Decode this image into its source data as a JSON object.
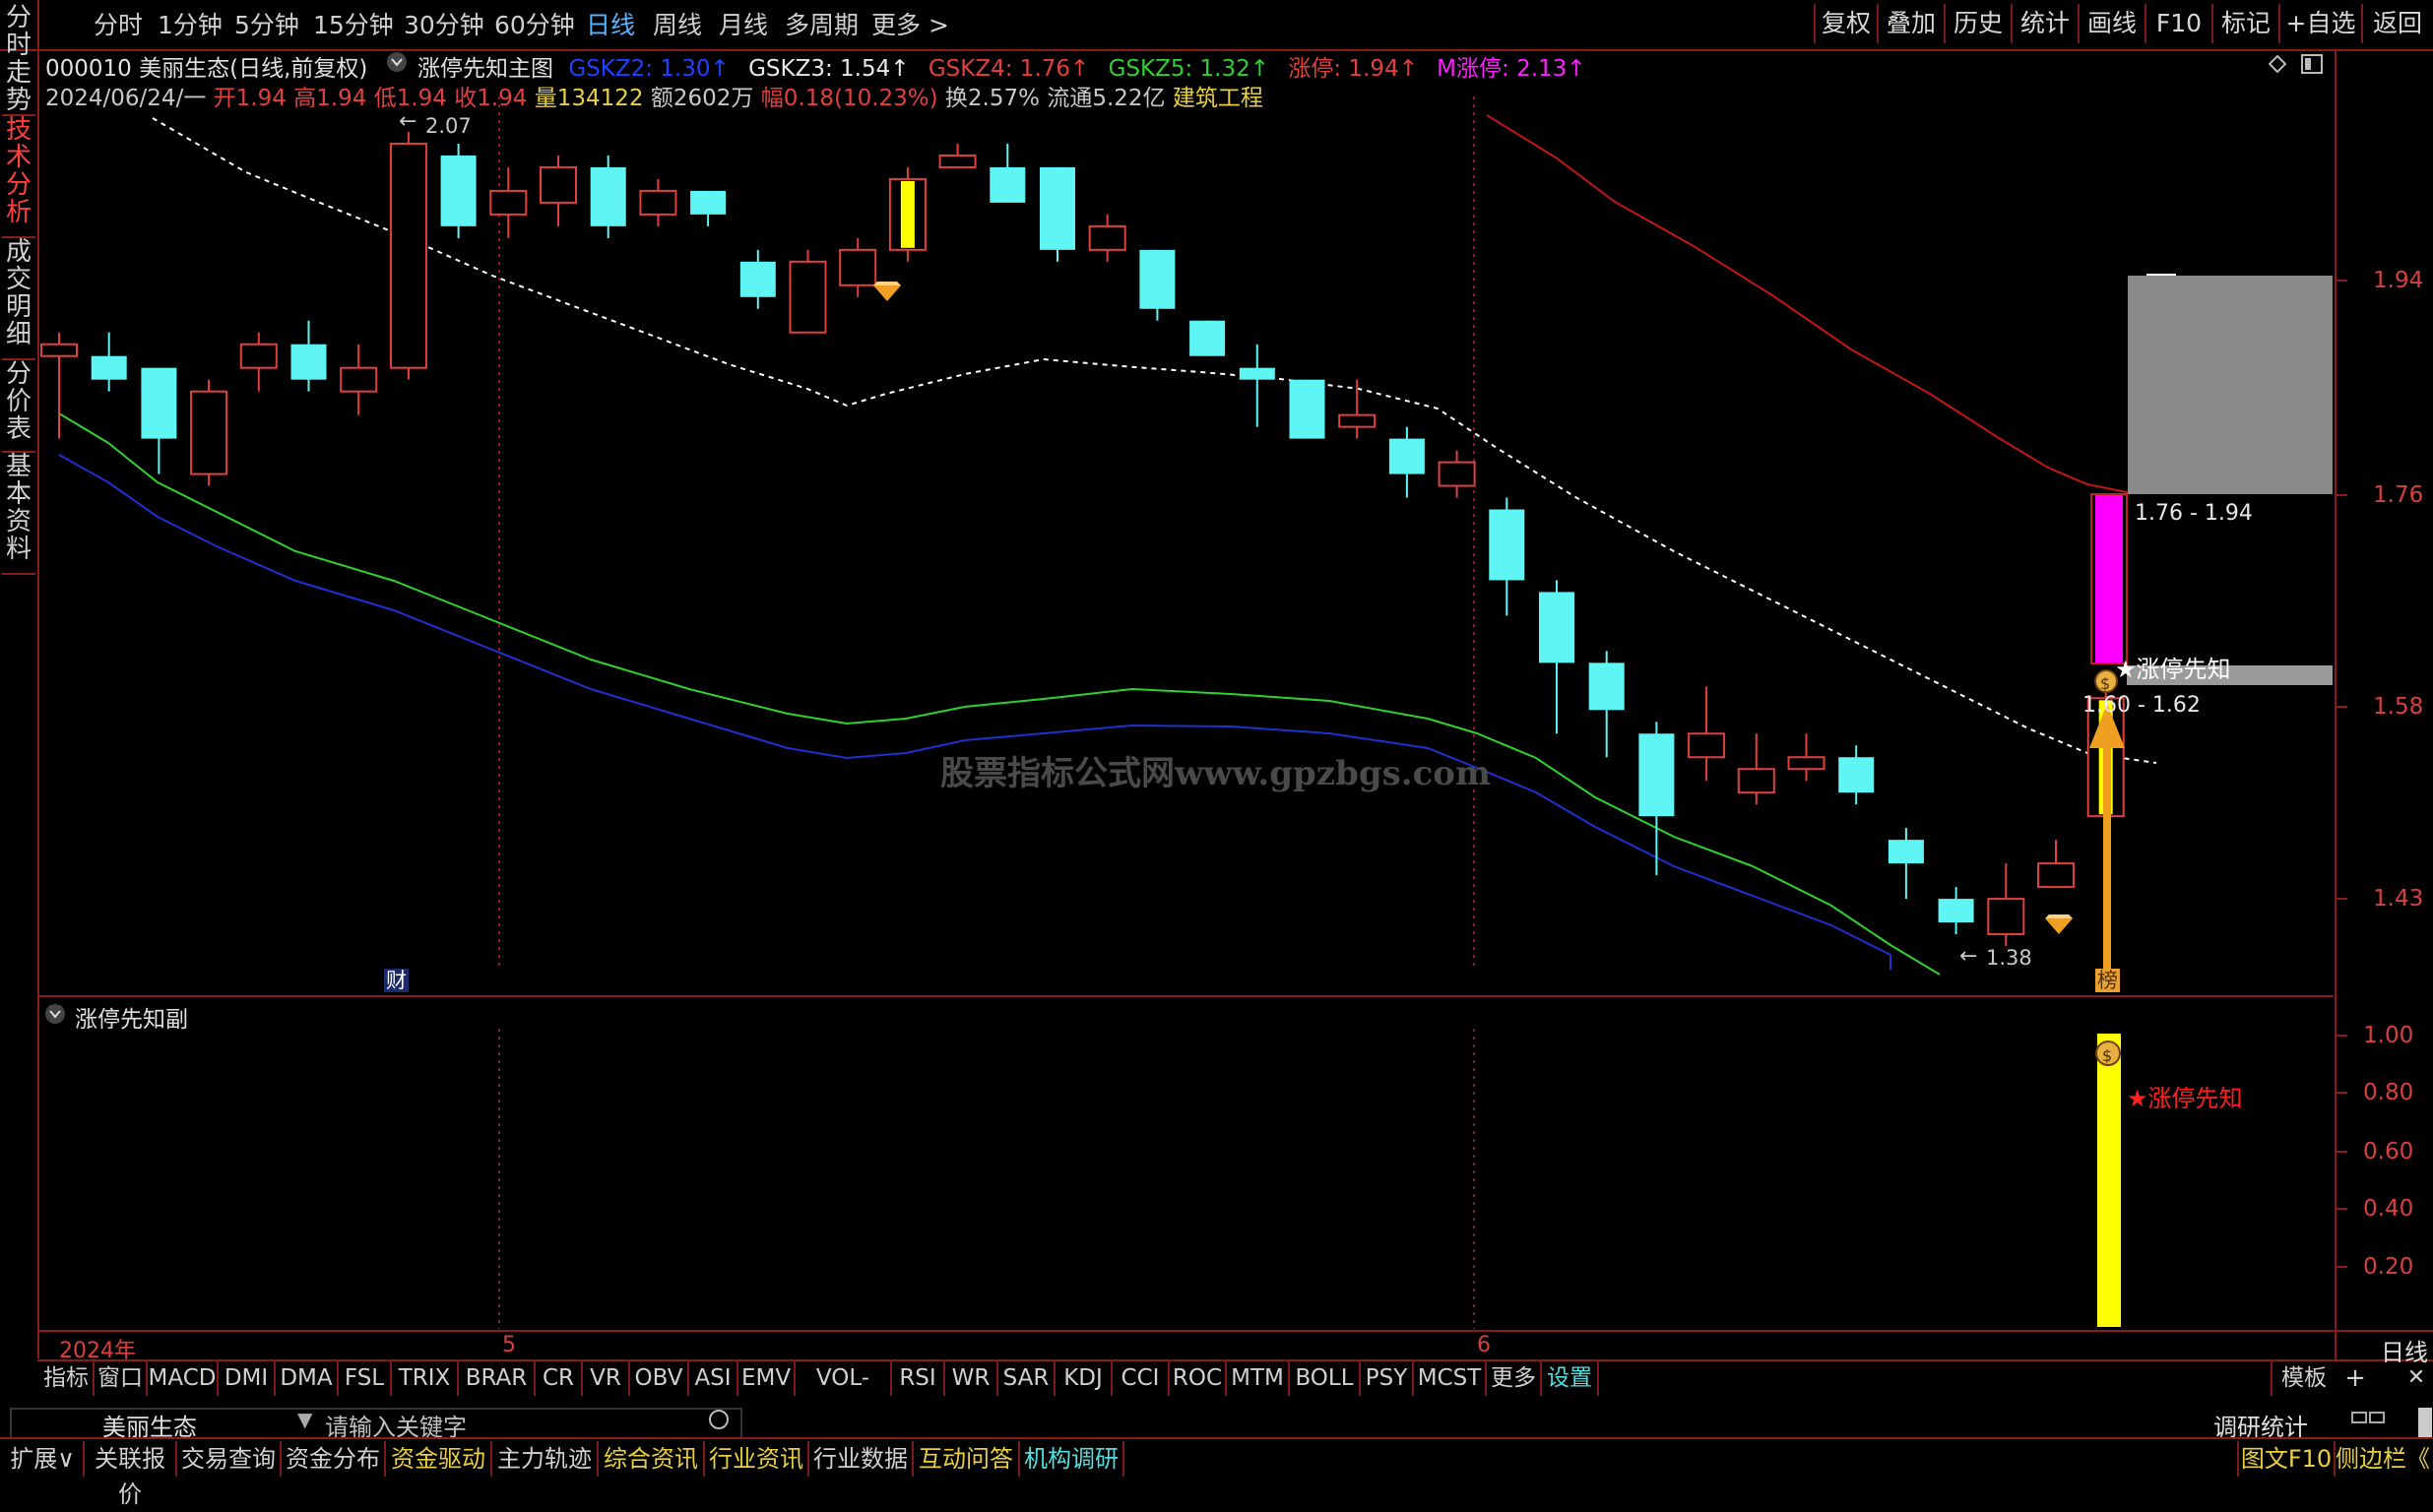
{
  "topbar": {
    "periods": [
      "分时",
      "1分钟",
      "5分钟",
      "15分钟",
      "30分钟",
      "60分钟",
      "日线",
      "周线",
      "月线",
      "多周期",
      "更多 >"
    ],
    "active_period": "日线",
    "right_buttons": [
      "复权",
      "叠加",
      "历史",
      "统计",
      "画线",
      "F10",
      "标记",
      "+自选",
      "返回"
    ]
  },
  "left_tabs": [
    "分时走势",
    "技术分析",
    "成交明细",
    "分价表",
    "基本资料"
  ],
  "stock": {
    "code_name": "000010 美丽生态(日线,前复权)",
    "indicator_name": "涨停先知主图",
    "gskz2": "GSKZ2: 1.30↑",
    "gskz3": "GSKZ3: 1.54↑",
    "gskz4": "GSKZ4: 1.76↑",
    "gskz5": "GSKZ5: 1.32↑",
    "zt": "涨停: 1.94↑",
    "mzt": "M涨停: 2.13↑",
    "date": "2024/06/24/一",
    "open": "开1.94",
    "high": "高1.94",
    "low": "低1.94",
    "close": "收1.94",
    "volume": "量134122",
    "amount": "额2602万",
    "change": "幅0.18(10.23%)",
    "turnover": "换2.57%",
    "float_cap": "流通5.22亿",
    "sector": "建筑工程"
  },
  "price_axis": [
    "1.94",
    "1.76",
    "1.58",
    "1.43"
  ],
  "annotations": {
    "high_mark": "2.07",
    "low_mark": "1.38",
    "range_upper": "1.76 - 1.94",
    "range_lower": "1.60 - 1.62",
    "star_label": "★涨停先知",
    "bang": "榜",
    "cai": "财",
    "watermark": "股票指标公式网www.gpzbgs.com"
  },
  "sub": {
    "title": "涨停先知副",
    "axis": [
      "1.00",
      "0.80",
      "0.60",
      "0.40",
      "0.20"
    ],
    "star_label": "★涨停先知"
  },
  "time_axis": [
    "2024年",
    "5",
    "6"
  ],
  "period_label": "日线",
  "indicators": [
    "指标",
    "窗口",
    "MACD",
    "DMI",
    "DMA",
    "FSL",
    "TRIX",
    "BRAR",
    "CR",
    "VR",
    "OBV",
    "ASI",
    "EMV",
    "VOL-TDX",
    "RSI",
    "WR",
    "SAR",
    "KDJ",
    "CCI",
    "ROC",
    "MTM",
    "BOLL",
    "PSY",
    "MCST",
    "更多",
    "设置"
  ],
  "indicator_right": [
    "模板",
    "+"
  ],
  "search": {
    "stock": "美丽生态",
    "placeholder": "请输入关键字"
  },
  "research_stats": "调研统计",
  "bottom_tabs": [
    "扩展∨",
    "关联报价",
    "交易查询",
    "资金分布",
    "资金驱动",
    "主力轨迹",
    "综合资讯",
    "行业资讯",
    "行业数据",
    "互动问答",
    "机构调研"
  ],
  "bottom_right": [
    "图文F10",
    "侧边栏《"
  ],
  "colors": {
    "up": "#e04040",
    "down": "#5ff5f5",
    "frame": "#8b1a1a",
    "yellow": "#ffff00",
    "magenta": "#ff00ff"
  },
  "chart_data": {
    "type": "candlestick",
    "ylim": [
      1.36,
      2.1
    ],
    "candles": [
      {
        "o": 1.88,
        "h": 1.9,
        "l": 1.81,
        "c": 1.89
      },
      {
        "o": 1.88,
        "h": 1.9,
        "l": 1.85,
        "c": 1.86
      },
      {
        "o": 1.87,
        "h": 1.87,
        "l": 1.78,
        "c": 1.81
      },
      {
        "o": 1.78,
        "h": 1.86,
        "l": 1.77,
        "c": 1.85
      },
      {
        "o": 1.87,
        "h": 1.9,
        "l": 1.85,
        "c": 1.89
      },
      {
        "o": 1.89,
        "h": 1.91,
        "l": 1.85,
        "c": 1.86
      },
      {
        "o": 1.85,
        "h": 1.89,
        "l": 1.83,
        "c": 1.87
      },
      {
        "o": 1.87,
        "h": 2.07,
        "l": 1.86,
        "c": 2.06
      },
      {
        "o": 2.05,
        "h": 2.06,
        "l": 1.98,
        "c": 1.99
      },
      {
        "o": 2.0,
        "h": 2.04,
        "l": 1.98,
        "c": 2.02
      },
      {
        "o": 2.01,
        "h": 2.05,
        "l": 1.99,
        "c": 2.04
      },
      {
        "o": 2.04,
        "h": 2.05,
        "l": 1.98,
        "c": 1.99
      },
      {
        "o": 2.0,
        "h": 2.03,
        "l": 1.99,
        "c": 2.02
      },
      {
        "o": 2.02,
        "h": 2.02,
        "l": 1.99,
        "c": 2.0
      },
      {
        "o": 1.96,
        "h": 1.97,
        "l": 1.92,
        "c": 1.93
      },
      {
        "o": 1.9,
        "h": 1.97,
        "l": 1.9,
        "c": 1.96
      },
      {
        "o": 1.94,
        "h": 1.98,
        "l": 1.93,
        "c": 1.97
      },
      {
        "o": 1.97,
        "h": 2.04,
        "l": 1.96,
        "c": 2.03
      },
      {
        "o": 2.04,
        "h": 2.06,
        "l": 2.04,
        "c": 2.05
      },
      {
        "o": 2.04,
        "h": 2.06,
        "l": 2.01,
        "c": 2.01
      },
      {
        "o": 2.04,
        "h": 2.04,
        "l": 1.96,
        "c": 1.97
      },
      {
        "o": 1.97,
        "h": 2.0,
        "l": 1.96,
        "c": 1.99
      },
      {
        "o": 1.97,
        "h": 1.97,
        "l": 1.91,
        "c": 1.92
      },
      {
        "o": 1.91,
        "h": 1.91,
        "l": 1.88,
        "c": 1.88
      },
      {
        "o": 1.87,
        "h": 1.89,
        "l": 1.82,
        "c": 1.86
      },
      {
        "o": 1.86,
        "h": 1.86,
        "l": 1.81,
        "c": 1.81
      },
      {
        "o": 1.82,
        "h": 1.86,
        "l": 1.81,
        "c": 1.83
      },
      {
        "o": 1.81,
        "h": 1.82,
        "l": 1.76,
        "c": 1.78
      },
      {
        "o": 1.77,
        "h": 1.8,
        "l": 1.76,
        "c": 1.79
      },
      {
        "o": 1.75,
        "h": 1.76,
        "l": 1.66,
        "c": 1.69
      },
      {
        "o": 1.68,
        "h": 1.69,
        "l": 1.56,
        "c": 1.62
      },
      {
        "o": 1.62,
        "h": 1.63,
        "l": 1.54,
        "c": 1.58
      },
      {
        "o": 1.56,
        "h": 1.57,
        "l": 1.44,
        "c": 1.49
      },
      {
        "o": 1.54,
        "h": 1.6,
        "l": 1.52,
        "c": 1.56
      },
      {
        "o": 1.51,
        "h": 1.56,
        "l": 1.5,
        "c": 1.53
      },
      {
        "o": 1.53,
        "h": 1.56,
        "l": 1.52,
        "c": 1.54
      },
      {
        "o": 1.54,
        "h": 1.55,
        "l": 1.5,
        "c": 1.51
      },
      {
        "o": 1.47,
        "h": 1.48,
        "l": 1.42,
        "c": 1.45
      },
      {
        "o": 1.42,
        "h": 1.43,
        "l": 1.39,
        "c": 1.4
      },
      {
        "o": 1.39,
        "h": 1.45,
        "l": 1.38,
        "c": 1.42
      },
      {
        "o": 1.43,
        "h": 1.47,
        "l": 1.43,
        "c": 1.45
      },
      {
        "o": 1.49,
        "h": 1.6,
        "l": 1.43,
        "c": 1.59
      }
    ]
  }
}
